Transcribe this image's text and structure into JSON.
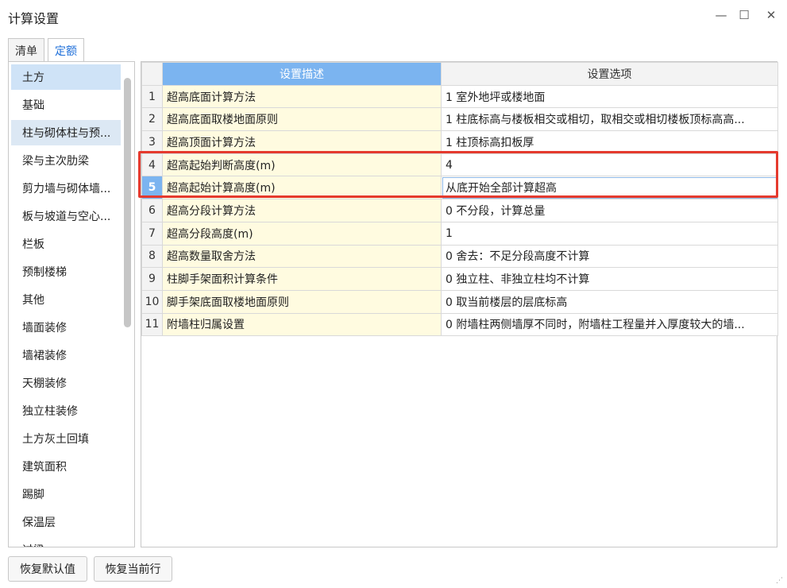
{
  "window": {
    "title": "计算设置",
    "minimize_glyph": "—",
    "maximize_glyph": "☐",
    "close_glyph": "✕"
  },
  "tabs": [
    {
      "label": "清单",
      "active": false
    },
    {
      "label": "定额",
      "active": true
    }
  ],
  "sidebar": {
    "items": [
      {
        "label": "土方"
      },
      {
        "label": "基础"
      },
      {
        "label": "柱与砌体柱与预..."
      },
      {
        "label": "梁与主次肋梁"
      },
      {
        "label": "剪力墙与砌体墙..."
      },
      {
        "label": "板与坡道与空心..."
      },
      {
        "label": "栏板"
      },
      {
        "label": "预制楼梯"
      },
      {
        "label": "其他"
      },
      {
        "label": "墙面装修"
      },
      {
        "label": "墙裙装修"
      },
      {
        "label": "天棚装修"
      },
      {
        "label": "独立柱装修"
      },
      {
        "label": "土方灰土回填"
      },
      {
        "label": "建筑面积"
      },
      {
        "label": "踢脚"
      },
      {
        "label": "保温层"
      },
      {
        "label": "过梁"
      }
    ]
  },
  "grid": {
    "headers": {
      "desc": "设置描述",
      "option": "设置选项"
    },
    "rows": [
      {
        "num": "1",
        "desc": "超高底面计算方法",
        "option": "1 室外地坪或楼地面"
      },
      {
        "num": "2",
        "desc": "超高底面取楼地面原则",
        "option": "1 柱底标高与楼板相交或相切，取相交或相切楼板顶标高高..."
      },
      {
        "num": "3",
        "desc": "超高顶面计算方法",
        "option": "1 柱顶标高扣板厚"
      },
      {
        "num": "4",
        "desc": "超高起始判断高度(m)",
        "option": "4"
      },
      {
        "num": "5",
        "desc": "超高起始计算高度(m)",
        "option": "从底开始全部计算超高"
      },
      {
        "num": "6",
        "desc": "超高分段计算方法",
        "option": "0 不分段，计算总量"
      },
      {
        "num": "7",
        "desc": "超高分段高度(m)",
        "option": "1"
      },
      {
        "num": "8",
        "desc": "超高数量取舍方法",
        "option": "0 舍去：不足分段高度不计算"
      },
      {
        "num": "9",
        "desc": "柱脚手架面积计算条件",
        "option": "0 独立柱、非独立柱均不计算"
      },
      {
        "num": "10",
        "desc": "脚手架底面取楼地面原则",
        "option": "0 取当前楼层的层底标高"
      },
      {
        "num": "11",
        "desc": "附墙柱归属设置",
        "option": "0 附墙柱两侧墙厚不同时，附墙柱工程量并入厚度较大的墙..."
      }
    ],
    "current_row": 5
  },
  "buttons": {
    "restore_default": "恢复默认值",
    "restore_current": "恢复当前行"
  },
  "colors": {
    "highlight_box": "#e53a2e",
    "header_selected": "#7bb4f0",
    "desc_cell_bg": "#fffbe0",
    "tab_active_text": "#1e6fd9"
  }
}
